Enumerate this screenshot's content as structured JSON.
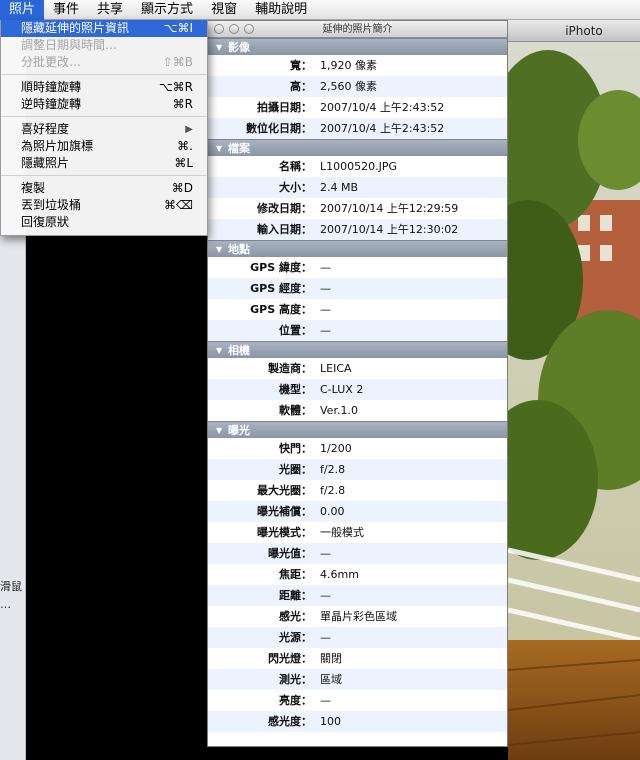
{
  "menubar": {
    "items": [
      "照片",
      "事件",
      "共享",
      "顯示方式",
      "視窗",
      "輔助說明"
    ],
    "active_index": 0
  },
  "dropdown": {
    "items": [
      {
        "label": "隱藏延伸的照片資訊",
        "shortcut": "⌥⌘I",
        "state": "highlighted"
      },
      {
        "label": "調整日期與時間…",
        "shortcut": "",
        "state": "disabled"
      },
      {
        "label": "分批更改…",
        "shortcut": "⇧⌘B",
        "state": "disabled"
      },
      {
        "separator": true
      },
      {
        "label": "順時鐘旋轉",
        "shortcut": "⌥⌘R",
        "state": "normal"
      },
      {
        "label": "逆時鐘旋轉",
        "shortcut": "⌘R",
        "state": "normal"
      },
      {
        "separator": true
      },
      {
        "label": "喜好程度",
        "shortcut": "▶",
        "state": "normal"
      },
      {
        "label": "為照片加旗標",
        "shortcut": "⌘.",
        "state": "normal"
      },
      {
        "label": "隱藏照片",
        "shortcut": "⌘L",
        "state": "normal"
      },
      {
        "separator": true
      },
      {
        "label": "複製",
        "shortcut": "⌘D",
        "state": "normal"
      },
      {
        "label": "丟到垃圾桶",
        "shortcut": "⌘⌫",
        "state": "normal"
      },
      {
        "label": "回復原狀",
        "shortcut": "",
        "state": "normal"
      }
    ]
  },
  "info_window": {
    "title": "延伸的照片簡介",
    "sections": [
      {
        "name": "影像",
        "rows": [
          {
            "k": "寬：",
            "v": "1,920 像素"
          },
          {
            "k": "高：",
            "v": "2,560 像素"
          },
          {
            "k": "拍攝日期：",
            "v": "2007/10/4 上午2:43:52"
          },
          {
            "k": "數位化日期：",
            "v": "2007/10/4 上午2:43:52"
          }
        ]
      },
      {
        "name": "檔案",
        "rows": [
          {
            "k": "名稱：",
            "v": "L1000520.JPG"
          },
          {
            "k": "大小：",
            "v": "2.4 MB"
          },
          {
            "k": "修改日期：",
            "v": "2007/10/14 上午12:29:59"
          },
          {
            "k": "輸入日期：",
            "v": "2007/10/14 上午12:30:02"
          }
        ]
      },
      {
        "name": "地點",
        "rows": [
          {
            "k": "GPS 緯度：",
            "v": "—"
          },
          {
            "k": "GPS 經度：",
            "v": "—"
          },
          {
            "k": "GPS 高度：",
            "v": "—"
          },
          {
            "k": "位置：",
            "v": "—"
          }
        ]
      },
      {
        "name": "相機",
        "rows": [
          {
            "k": "製造商：",
            "v": "LEICA"
          },
          {
            "k": "機型：",
            "v": "C-LUX 2"
          },
          {
            "k": "軟體：",
            "v": "Ver.1.0"
          }
        ]
      },
      {
        "name": "曝光",
        "rows": [
          {
            "k": "快門：",
            "v": "1/200"
          },
          {
            "k": "光圈：",
            "v": "f/2.8"
          },
          {
            "k": "最大光圈：",
            "v": "f/2.8"
          },
          {
            "k": "曝光補償：",
            "v": "0.00"
          },
          {
            "k": "曝光模式：",
            "v": "一般模式"
          },
          {
            "k": "曝光值：",
            "v": "—"
          },
          {
            "k": "焦距：",
            "v": "4.6mm"
          },
          {
            "k": "距離：",
            "v": "—"
          },
          {
            "k": "感光：",
            "v": "單晶片彩色區域"
          },
          {
            "k": "光源：",
            "v": "—"
          },
          {
            "k": "閃光燈：",
            "v": "關閉"
          },
          {
            "k": "測光：",
            "v": "區域"
          },
          {
            "k": "亮度：",
            "v": "—"
          },
          {
            "k": "感光度：",
            "v": "100"
          }
        ]
      }
    ]
  },
  "iphoto_window": {
    "title": "iPhoto"
  },
  "left_strip": {
    "text1": "滑鼠",
    "text2": "…"
  },
  "colors": {
    "menu_highlight": "#2a66d6",
    "section_header": "#8f9aab",
    "alt_row": "#edf3fe"
  }
}
